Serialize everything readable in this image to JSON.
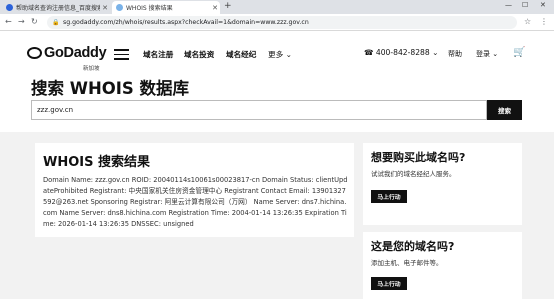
{
  "browser": {
    "tabs": [
      {
        "label": "帮助域名查询注册信息_百度搜索",
        "active": false
      },
      {
        "label": "WHOIS 搜索结果",
        "active": true
      }
    ],
    "new_tab": "+",
    "window_controls": {
      "minimize": "—",
      "maximize": "☐",
      "close": "✕"
    },
    "url": "sg.godaddy.com/zh/whois/results.aspx?checkAvail=1&domain=www.zzz.gov.cn",
    "icons": {
      "back": "back-arrow-icon",
      "forward": "forward-arrow-icon",
      "reload": "reload-icon",
      "lock": "lock-icon"
    }
  },
  "header": {
    "logo_text": "GoDaddy",
    "logo_sub": "新加坡",
    "nav": [
      "域名注册",
      "域名投资",
      "域名经纪",
      "更多 ⌄"
    ],
    "phone": "400-842-8288 ⌄",
    "help": "帮助",
    "login": "登录 ⌄"
  },
  "search": {
    "title": "搜索 WHOIS 数据库",
    "value": "zzz.gov.cn",
    "button": "搜索"
  },
  "result": {
    "title": "WHOIS 搜索结果",
    "body": "Domain Name: zzz.gov.cn ROID: 20040114s10061s00023817-cn Domain Status: clientUpdateProhibited Registrant: 中央国家机关住房资金管理中心 Registrant Contact Email: 13901327592@263.net Sponsoring Registrar: 阿里云计算有限公司（万网） Name Server: dns7.hichina.com Name Server: dns8.hichina.com Registration Time: 2004-01-14 13:26:35 Expiration Time: 2026-01-14 13:26:35 DNSSEC: unsigned"
  },
  "sidebar": [
    {
      "title": "想要购买此域名吗?",
      "text": "试试我们的域名经纪人服务。",
      "button": "马上行动"
    },
    {
      "title": "这是您的域名吗?",
      "text": "添加主机、电子邮件等。",
      "button": "马上行动"
    }
  ],
  "colors": {
    "accent": "#111111",
    "page_bg": "#f2f2f2"
  }
}
